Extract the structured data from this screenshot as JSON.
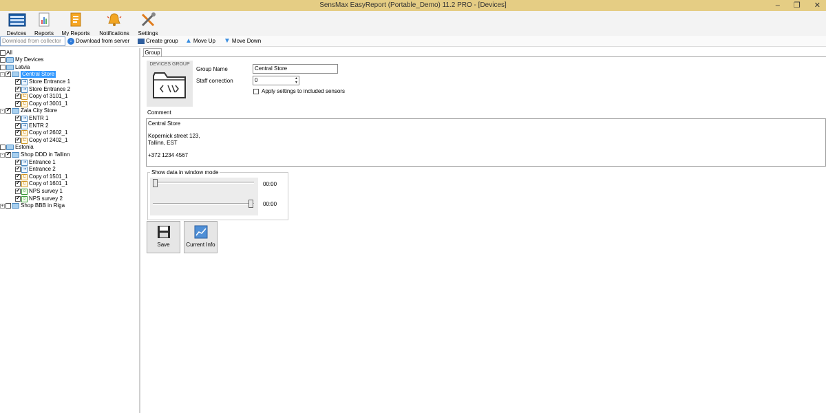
{
  "window": {
    "title": "SensMax EasyReport (Portable_Demo) 11.2 PRO - [Devices]",
    "controls": [
      "–",
      "❐",
      "✕"
    ]
  },
  "ribbon": {
    "devices": "Devices",
    "reports": "Reports",
    "my_reports": "My Reports",
    "notifications": "Notifications",
    "settings": "Settings"
  },
  "toolbar": {
    "download_collector": "Download from collector",
    "download_server": "Download from server",
    "create_group": "Create group",
    "move_up": "Move Up",
    "move_down": "Move Down"
  },
  "tree": {
    "all": "All",
    "my_devices": "My Devices",
    "latvia": "Latvia",
    "central_store": "Central Store",
    "store_entrance_1": "Store Entrance 1",
    "store_entrance_2": "Store Entrance 2",
    "copy_3101": "Copy of 3101_1",
    "copy_3001": "Copy of 3001_1",
    "zala_city_store": "Zala City Store",
    "entr_1": "ENTR 1",
    "entr_2": "ENTR 2",
    "copy_2602": "Copy of 2602_1",
    "copy_2402": "Copy of 2402_1",
    "estonia": "Estonia",
    "shop_ddd": "Shop DDD in Tallinn",
    "entrance_1": "Entrance 1",
    "entrance_2": "Entrance 2",
    "copy_1501": "Copy of 1501_1",
    "copy_1601": "Copy of 1601_1",
    "nps_survey_1": "NPS survey 1",
    "nps_survey_2": "NPS survey 2",
    "shop_bbb": "Shop BBB in Riga"
  },
  "group": {
    "tab": "Group",
    "devices_group": "DEVICES GROUP",
    "group_name_label": "Group Name",
    "group_name_value": "Central Store",
    "staff_correction_label": "Staff correction",
    "staff_correction_value": "0",
    "apply_settings": "Apply settings to included sensors",
    "comment_label": "Comment",
    "comment_line1": "Central Store",
    "comment_line2": "Kopernick street 123,",
    "comment_line3": "Tallinn, EST",
    "comment_line4": "+372 1234 4567",
    "window_mode_label": "Show data in window mode",
    "time_start": "00:00",
    "time_end": "00:00",
    "save": "Save",
    "current_info": "Current Info"
  }
}
